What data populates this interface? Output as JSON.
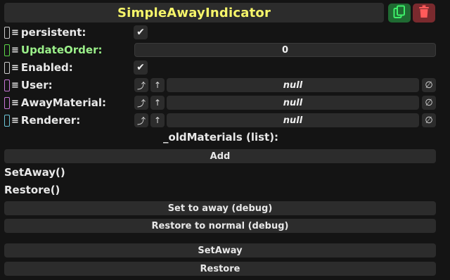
{
  "header": {
    "title": "SimpleAwayIndicator"
  },
  "fields": [
    {
      "label": "persistent:",
      "type_color": "#cccccc",
      "checked": true,
      "check_glyph": "✔"
    },
    {
      "label": "UpdateOrder:",
      "type_color": "#5ed84a",
      "value": "0"
    },
    {
      "label": "Enabled:",
      "type_color": "#cccccc",
      "checked": true,
      "check_glyph": "✔"
    },
    {
      "label": "User:",
      "type_color": "#c877d8",
      "value": "null"
    },
    {
      "label": "AwayMaterial:",
      "type_color": "#c877d8",
      "value": "null"
    },
    {
      "label": "Renderer:",
      "type_color": "#6ec6d8",
      "value": "null"
    }
  ],
  "ref_icons": {
    "jump": "⤴",
    "up": "↑",
    "clear": "∅"
  },
  "list": {
    "title": "_oldMaterials (list):",
    "add_label": "Add"
  },
  "methods": [
    "SetAway()",
    "Restore()"
  ],
  "buttons": {
    "set_away_debug": "Set to away (debug)",
    "restore_debug": "Restore to normal (debug)",
    "set_away": "SetAway",
    "restore": "Restore"
  },
  "colors": {
    "title": "#f6f56a",
    "duplicate_bg": "#1f6a32",
    "delete_bg": "#7a2a2e",
    "green_label": "#9bf08a"
  },
  "icons": {
    "duplicate": "duplicate-icon",
    "delete": "trash-icon",
    "drag": "≡"
  }
}
